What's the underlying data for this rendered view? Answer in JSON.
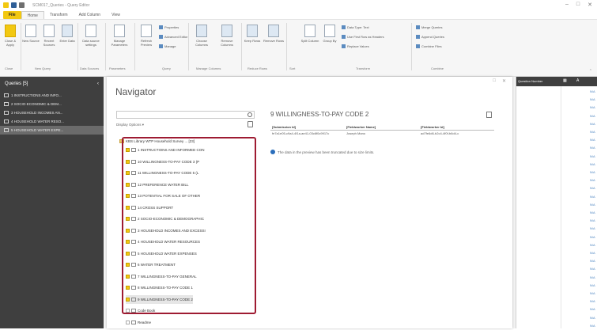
{
  "title_bar": {
    "title": "SCM017_Queries - Query Editor",
    "window_controls": [
      "–",
      "□",
      "✕"
    ],
    "quick_access_colors": [
      "#f2c811",
      "#2f5f97",
      "#6f6f6f"
    ]
  },
  "tabs": [
    {
      "label": "File"
    },
    {
      "label": "Home"
    },
    {
      "label": "Transform"
    },
    {
      "label": "Add Column"
    },
    {
      "label": "View"
    }
  ],
  "ribbon": {
    "close_apply": "Close & Apply",
    "new_source": "New Source",
    "recent_sources": "Recent Sources",
    "enter_data": "Enter Data",
    "data_source_settings": "Data source settings",
    "manage_parameters": "Manage Parameters",
    "refresh_preview": "Refresh Preview",
    "properties": "Properties",
    "advanced_editor": "Advanced Editor",
    "manage": "Manage",
    "choose_columns": "Choose Columns",
    "remove_columns": "Remove Columns",
    "keep_rows": "Keep Rows",
    "remove_rows": "Remove Rows",
    "split_column": "Split Column",
    "group_by": "Group By",
    "data_type": "Data Type: Text",
    "use_first_row": "Use First Row as Headers",
    "replace_values": "Replace Values",
    "merge_queries": "Merge Queries",
    "append_queries": "Append Queries",
    "combine_files": "Combine Files",
    "groups": [
      "Close",
      "New Query",
      "Data Sources",
      "Parameters",
      "Query",
      "Manage Columns",
      "Reduce Rows",
      "Sort",
      "Transform",
      "Combine"
    ]
  },
  "queries_pane": {
    "header": "Queries [5]",
    "items": [
      "1 INSTRUCTIONS AND INFO...",
      "2 SOCIO-ECONOMIC & DEM...",
      "3 HOUSEHOLD INCOMES AN...",
      "4 HOUSEHOLD WATER RESO...",
      "5 HOUSEHOLD WATER EXPE..."
    ],
    "selected_index": 4
  },
  "navigator": {
    "title": "Navigator",
    "display_options": "Display Options",
    "root_item": "KBS Library WTP Household Survey ... [23]",
    "items": [
      {
        "label": "1 INSTRUCTIONS AND INFORMED CON",
        "checked": true
      },
      {
        "label": "10 WILLINGNESS-TO-PAY CODE 3 (P",
        "checked": true
      },
      {
        "label": "11 WILLINGNESS-TO-PAY CODE 5 (L",
        "checked": true
      },
      {
        "label": "12 PREFERENCE WATER BILL",
        "checked": true
      },
      {
        "label": "13 POTENTIAL FOR SALE OF OTHER",
        "checked": true
      },
      {
        "label": "14 CROSS SUPPORT",
        "checked": true
      },
      {
        "label": "2 SOCIO-ECONOMIC & DEMOGRAPHIC",
        "checked": true
      },
      {
        "label": "3 HOUSEHOLD INCOMES AND EXCESSI",
        "checked": true
      },
      {
        "label": "4 HOUSEHOLD WATER RESOURCES",
        "checked": true
      },
      {
        "label": "5 HOUSEHOLD WATER EXPENSES",
        "checked": true
      },
      {
        "label": "6 WATER TREATMENT",
        "checked": true
      },
      {
        "label": "7 WILLINGNESS-TO-PAY GENERAL",
        "checked": true
      },
      {
        "label": "8 WILLINGNESS-TO-PAY CODE 1",
        "checked": true
      },
      {
        "label": "9 WILLINGNESS-TO-PAY CODE 2",
        "checked": true
      },
      {
        "label": "Code Book",
        "checked": false
      },
      {
        "label": "Readme",
        "checked": false
      }
    ],
    "selected_index": 13
  },
  "preview": {
    "title": "9 WILLINGNESS-TO-PAY CODE 2",
    "columns": [
      "[Submission Id]",
      "[Fieldworker Name]",
      "[Fieldworker Id]"
    ],
    "row": [
      "fe7a1e05-c9a4-4f1a-ae41-03c6f0c9917c",
      "Joseph Mano",
      "ad7fe6d6-b2c4-4f0f-b6d4-c"
    ],
    "info": "The data in the preview has been truncated due to size limits."
  },
  "grid": {
    "column_name": "Question Number",
    "cell_value": "N/A",
    "rows": 30
  }
}
